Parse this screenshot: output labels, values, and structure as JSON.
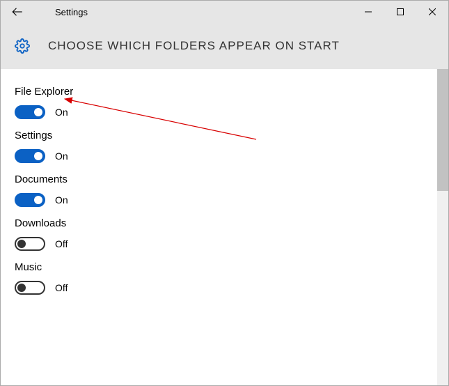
{
  "titlebar": {
    "title": "Settings"
  },
  "header": {
    "title": "CHOOSE WHICH FOLDERS APPEAR ON START"
  },
  "onLabel": "On",
  "offLabel": "Off",
  "items": [
    {
      "label": "File Explorer",
      "state": "On"
    },
    {
      "label": "Settings",
      "state": "On"
    },
    {
      "label": "Documents",
      "state": "On"
    },
    {
      "label": "Downloads",
      "state": "Off"
    },
    {
      "label": "Music",
      "state": "Off"
    }
  ]
}
